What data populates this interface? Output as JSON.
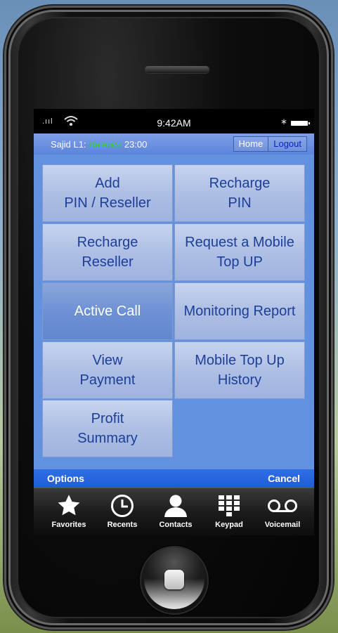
{
  "status": {
    "signal": ".ııl",
    "time": "9:42AM",
    "bluetooth": "∗"
  },
  "info": {
    "user_prefix": "Sajid L1:",
    "balance_label": "Balance",
    "balance_value": "23:00",
    "home_label": "Home",
    "logout_label": "Logout"
  },
  "menu": [
    {
      "label": "Add\nPIN / Reseller"
    },
    {
      "label": "Recharge\nPIN"
    },
    {
      "label": "Recharge\nReseller"
    },
    {
      "label": "Request a Mobile\nTop UP"
    },
    {
      "label": "Active Call"
    },
    {
      "label": "Monitoring Report"
    },
    {
      "label": "View\nPayment"
    },
    {
      "label": "Mobile Top Up\nHistory"
    },
    {
      "label": "Profit\nSummary"
    }
  ],
  "options_bar": {
    "left": "Options",
    "right": "Cancel"
  },
  "tabs": [
    {
      "label": "Favorites",
      "icon": "star-icon"
    },
    {
      "label": "Recents",
      "icon": "clock-icon"
    },
    {
      "label": "Contacts",
      "icon": "person-icon"
    },
    {
      "label": "Keypad",
      "icon": "keypad-icon"
    },
    {
      "label": "Voicemail",
      "icon": "voicemail-icon"
    }
  ],
  "colors": {
    "accent": "#1f5cd6",
    "balance": "#2fd136",
    "tile_text": "#1d3e97",
    "content_bg": "#6291e0"
  }
}
